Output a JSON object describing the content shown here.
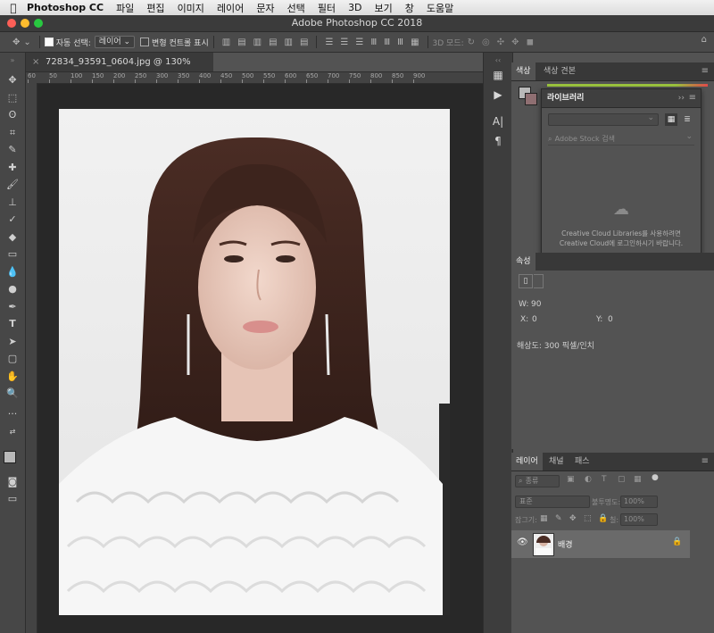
{
  "menubar": {
    "app_name": "Photoshop CC",
    "items": [
      "파일",
      "편집",
      "이미지",
      "레이어",
      "문자",
      "선택",
      "필터",
      "3D",
      "보기",
      "창",
      "도움말"
    ]
  },
  "window": {
    "title": "Adobe Photoshop CC 2018",
    "traffic_colors": [
      "#fd5f57",
      "#febc2e",
      "#28c840"
    ]
  },
  "options_bar": {
    "auto_select_label": "자동 선택:",
    "auto_select_checked": true,
    "auto_select_target": "레이어",
    "transform_controls_label": "변형 컨트롤 표시",
    "transform_controls_checked": false,
    "mode_3d_label": "3D 모드:"
  },
  "document": {
    "tab_title": "72834_93591_0604.jpg @ 130% (RGB/8) *",
    "ruler_labels": [
      "60",
      "50",
      "100",
      "150",
      "200",
      "250",
      "300",
      "350",
      "400",
      "450",
      "500",
      "550",
      "600",
      "650",
      "700",
      "750",
      "800",
      "850",
      "900"
    ]
  },
  "panels": {
    "color": {
      "tabs": [
        "색상",
        "색상 견본"
      ],
      "active": 0
    },
    "libraries": {
      "title": "라이브러리",
      "search_placeholder": "Adobe Stock 검색",
      "empty_line1": "Creative Cloud Libraries를 사용하려면",
      "empty_line2": "Creative Cloud에 로그인하시기 바랍니다."
    },
    "properties": {
      "tab": "속성",
      "w_label": "W:",
      "w_value": "90",
      "x_label": "X:",
      "x_value": "0",
      "y_label": "Y:",
      "y_value": "0",
      "resolution": "해상도: 300 픽셀/인치"
    },
    "layers": {
      "tabs": [
        "레이어",
        "채널",
        "패스"
      ],
      "active": 0,
      "filter_label": "종류",
      "blend_mode": "표준",
      "opacity_label": "불투명도:",
      "opacity_value": "100%",
      "lock_label": "잠그기:",
      "fill_label": "칠:",
      "fill_value": "100%",
      "layer_name": "배경"
    }
  },
  "colors": {
    "fg_swatch": "#b9b9b9",
    "bg_swatch": "#8f6f72"
  }
}
